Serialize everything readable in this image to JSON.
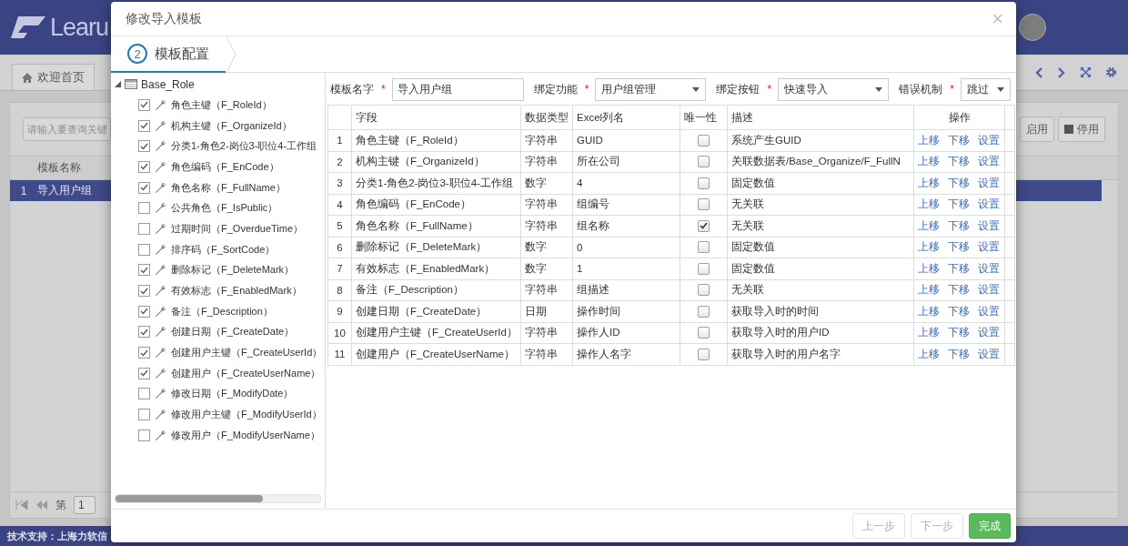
{
  "app": {
    "logo": "Learu",
    "tabs": [
      {
        "label": "欢迎首页",
        "selected": false
      }
    ],
    "search": {
      "placeholder": "请输入要查询关键"
    },
    "toolbar": [
      {
        "label": "启用",
        "kind": "enable"
      },
      {
        "label": "停用",
        "kind": "disable"
      }
    ],
    "grid": {
      "columns": [
        "模板名称"
      ],
      "rows": [
        {
          "index": "1",
          "name": "导入用户组",
          "selected": true
        }
      ]
    },
    "pager": {
      "label": "第",
      "page": "1"
    },
    "footer": "技术支持：上海力软信"
  },
  "dialog": {
    "title": "修改导入模板",
    "close": "×",
    "step": {
      "number": "2",
      "label": "模板配置"
    },
    "tree": {
      "root": "Base_Role",
      "expanded": true,
      "children": [
        {
          "label": "角色主键（F_RoleId）",
          "checked": true
        },
        {
          "label": "机构主键（F_OrganizeId）",
          "checked": true
        },
        {
          "label": "分类1-角色2-岗位3-职位4-工作组",
          "checked": true
        },
        {
          "label": "角色编码（F_EnCode）",
          "checked": true
        },
        {
          "label": "角色名称（F_FullName）",
          "checked": true
        },
        {
          "label": "公共角色（F_IsPublic）",
          "checked": false
        },
        {
          "label": "过期时间（F_OverdueTime）",
          "checked": false
        },
        {
          "label": "排序码（F_SortCode）",
          "checked": false
        },
        {
          "label": "删除标记（F_DeleteMark）",
          "checked": true
        },
        {
          "label": "有效标志（F_EnabledMark）",
          "checked": true
        },
        {
          "label": "备注（F_Description）",
          "checked": true
        },
        {
          "label": "创建日期（F_CreateDate）",
          "checked": true
        },
        {
          "label": "创建用户主键（F_CreateUserId）",
          "checked": true
        },
        {
          "label": "创建用户（F_CreateUserName）",
          "checked": true
        },
        {
          "label": "修改日期（F_ModifyDate）",
          "checked": false
        },
        {
          "label": "修改用户主键（F_ModifyUserId）",
          "checked": false
        },
        {
          "label": "修改用户（F_ModifyUserName）",
          "checked": false
        }
      ]
    },
    "form": [
      {
        "label": "模板名字",
        "required_mark": "*",
        "kind": "text",
        "value": "导入用户组"
      },
      {
        "label": "绑定功能",
        "required_mark": "*",
        "kind": "select",
        "value": "用户组管理"
      },
      {
        "label": "绑定按钮",
        "required_mark": "*",
        "kind": "select",
        "value": "快速导入"
      },
      {
        "label": "错误机制",
        "required_mark": "*",
        "kind": "select",
        "value": "跳过"
      }
    ],
    "table": {
      "columns": [
        "字段",
        "数据类型",
        "Excel列名",
        "唯一性",
        "描述",
        "操作"
      ],
      "rows": [
        {
          "index": "1",
          "field": "角色主键（F_RoleId）",
          "type": "字符串",
          "excel": "GUID",
          "unique": false,
          "description": "系统产生GUID",
          "actions": [
            "上移",
            "下移",
            "设置"
          ]
        },
        {
          "index": "2",
          "field": "机构主键（F_OrganizeId）",
          "type": "字符串",
          "excel": "所在公司",
          "unique": false,
          "description": "关联数据表/Base_Organize/F_FullN",
          "actions": [
            "上移",
            "下移",
            "设置"
          ]
        },
        {
          "index": "3",
          "field": "分类1-角色2-岗位3-职位4-工作组",
          "type": "数字",
          "excel": "4",
          "unique": false,
          "description": "固定数值",
          "actions": [
            "上移",
            "下移",
            "设置"
          ]
        },
        {
          "index": "4",
          "field": "角色编码（F_EnCode）",
          "type": "字符串",
          "excel": "组编号",
          "unique": false,
          "description": "无关联",
          "actions": [
            "上移",
            "下移",
            "设置"
          ]
        },
        {
          "index": "5",
          "field": "角色名称（F_FullName）",
          "type": "字符串",
          "excel": "组名称",
          "unique": true,
          "description": "无关联",
          "actions": [
            "上移",
            "下移",
            "设置"
          ]
        },
        {
          "index": "6",
          "field": "删除标记（F_DeleteMark）",
          "type": "数字",
          "excel": "0",
          "unique": false,
          "description": "固定数值",
          "actions": [
            "上移",
            "下移",
            "设置"
          ]
        },
        {
          "index": "7",
          "field": "有效标志（F_EnabledMark）",
          "type": "数字",
          "excel": "1",
          "unique": false,
          "description": "固定数值",
          "actions": [
            "上移",
            "下移",
            "设置"
          ]
        },
        {
          "index": "8",
          "field": "备注（F_Description）",
          "type": "字符串",
          "excel": "组描述",
          "unique": false,
          "description": "无关联",
          "actions": [
            "上移",
            "下移",
            "设置"
          ]
        },
        {
          "index": "9",
          "field": "创建日期（F_CreateDate）",
          "type": "日期",
          "excel": "操作时间",
          "unique": false,
          "description": "获取导入时的时间",
          "actions": [
            "上移",
            "下移",
            "设置"
          ]
        },
        {
          "index": "10",
          "field": "创建用户主键（F_CreateUserId）",
          "type": "字符串",
          "excel": "操作人ID",
          "unique": false,
          "description": "获取导入时的用户ID",
          "actions": [
            "上移",
            "下移",
            "设置"
          ]
        },
        {
          "index": "11",
          "field": "创建用户（F_CreateUserName）",
          "type": "字符串",
          "excel": "操作人名字",
          "unique": false,
          "description": "获取导入时的用户名字",
          "actions": [
            "上移",
            "下移",
            "设置"
          ]
        }
      ]
    },
    "buttons": [
      {
        "label": "上一步",
        "disabled": true
      },
      {
        "label": "下一步",
        "disabled": true
      },
      {
        "label": "完成",
        "disabled": false
      }
    ]
  }
}
